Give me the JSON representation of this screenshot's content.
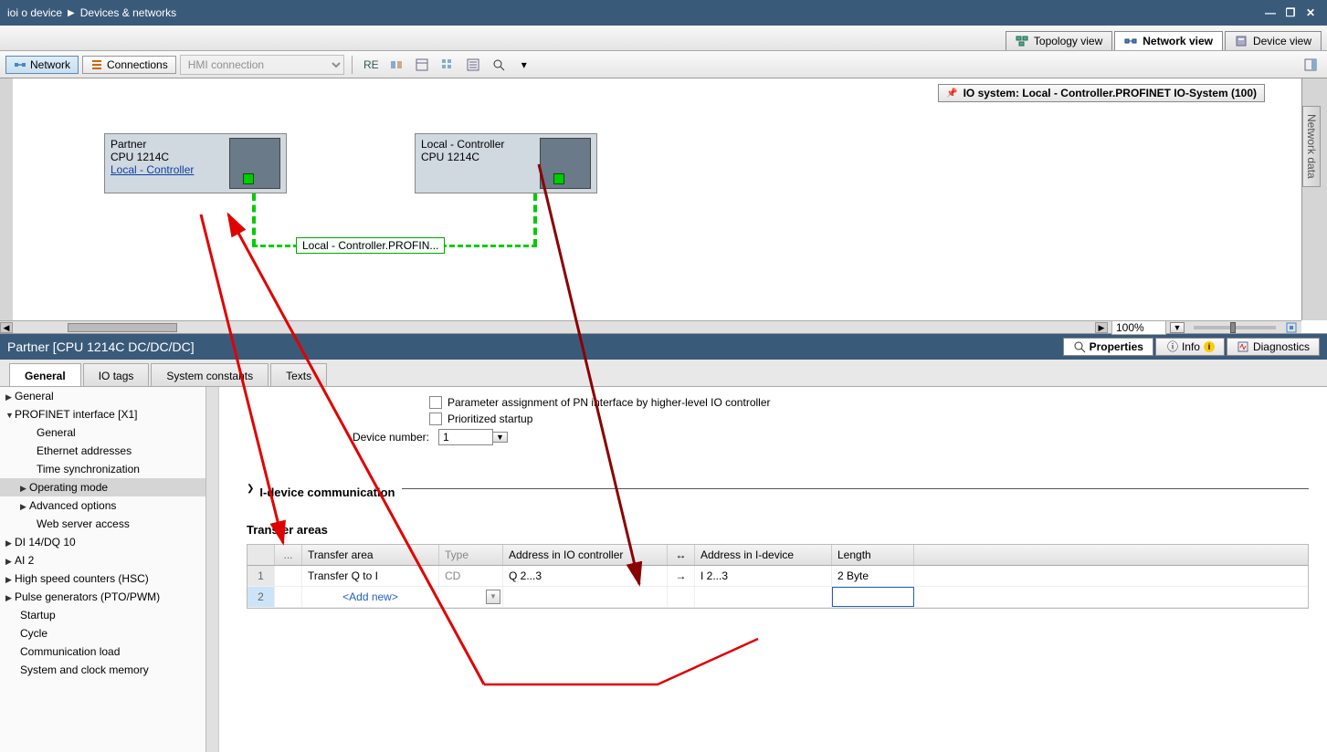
{
  "titlebar": {
    "crumb1": "ioi o device",
    "crumb2": "Devices & networks"
  },
  "viewTabs": {
    "topology": "Topology view",
    "network": "Network view",
    "device": "Device view"
  },
  "netbar": {
    "network": "Network",
    "connections": "Connections",
    "connType": "HMI connection"
  },
  "ioSystem": "IO system: Local - Controller.PROFINET IO-System (100)",
  "devices": {
    "partner": {
      "name": "Partner",
      "cpu": "CPU 1214C",
      "link": "Local - Controller"
    },
    "local": {
      "name": "Local - Controller",
      "cpu": "CPU 1214C"
    }
  },
  "netLabel": "Local - Controller.PROFIN...",
  "zoom": "100%",
  "sidePanel": "Network data",
  "propHeader": {
    "title": "Partner [CPU 1214C DC/DC/DC]",
    "properties": "Properties",
    "info": "Info",
    "diagnostics": "Diagnostics"
  },
  "innerTabs": {
    "general": "General",
    "iotags": "IO tags",
    "sysconst": "System constants",
    "texts": "Texts"
  },
  "nav": {
    "general": "General",
    "profinet": "PROFINET interface [X1]",
    "pn_general": "General",
    "eth": "Ethernet addresses",
    "timesync": "Time synchronization",
    "opmode": "Operating mode",
    "advopt": "Advanced options",
    "webaccess": "Web server access",
    "di14": "DI 14/DQ 10",
    "ai2": "AI 2",
    "hsc": "High speed counters (HSC)",
    "pto": "Pulse generators (PTO/PWM)",
    "startup": "Startup",
    "cycle": "Cycle",
    "commload": "Communication load",
    "sysclock": "System and clock memory"
  },
  "form": {
    "cbx1": "Parameter assignment of PN interface by higher-level IO controller",
    "cbx2": "Prioritized startup",
    "devnum_label": "Device number:",
    "devnum": "1",
    "idevice": "I-device communication",
    "transfer": "Transfer areas"
  },
  "txTable": {
    "headers": {
      "dots": "...",
      "name": "Transfer area",
      "type": "Type",
      "addrCtrl": "Address in IO controller",
      "dir": "↔",
      "addrDev": "Address in I-device",
      "len": "Length"
    },
    "row1": {
      "name": "Transfer Q to I",
      "type": "CD",
      "addrCtrl": "Q 2...3",
      "dir": "→",
      "addrDev": "I 2...3",
      "len": "2 Byte"
    },
    "row2": {
      "addnew": "<Add new>"
    }
  }
}
